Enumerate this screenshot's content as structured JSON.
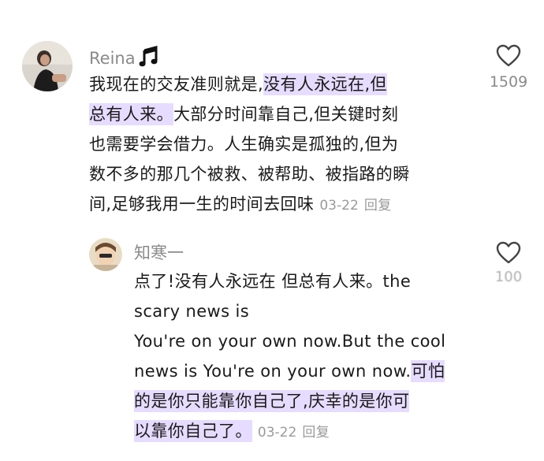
{
  "comment": {
    "username": "Reina",
    "music_icon": "music-note-icon",
    "line1": "我现在的交友准则就是,",
    "line1_hl": "没有人永远在,但",
    "line2_hl": "总有人来。",
    "line2": "大部分时间靠自己,但关键时刻",
    "line3": "也需要学会借力。人生确实是孤独的,但为",
    "line4": "数不多的那几个被救、被帮助、被指路的瞬",
    "line5": "间,足够我用一生的时间去回味",
    "date": "03-22",
    "reply_label": "回复",
    "likes": "1509",
    "like_icon": "heart-outline-icon"
  },
  "reply": {
    "username": "知寒一",
    "line1": "点了!没有人永远在 但总有人来。the",
    "line2": "scary news is",
    "line3": "You're on your own now.But the cool",
    "line4": "news is You're on your own now.",
    "line4_hl": "可怕",
    "line5_hl": "的是你只能靠你自己了,庆幸的是你可",
    "line6_hl": "以靠你自己了。",
    "date": "03-22",
    "reply_label": "回复",
    "likes": "100",
    "like_icon": "heart-outline-icon"
  },
  "colors": {
    "highlight": "#e6dcff",
    "meta_gray": "#9a9a9a",
    "text": "#1a1a1a"
  }
}
